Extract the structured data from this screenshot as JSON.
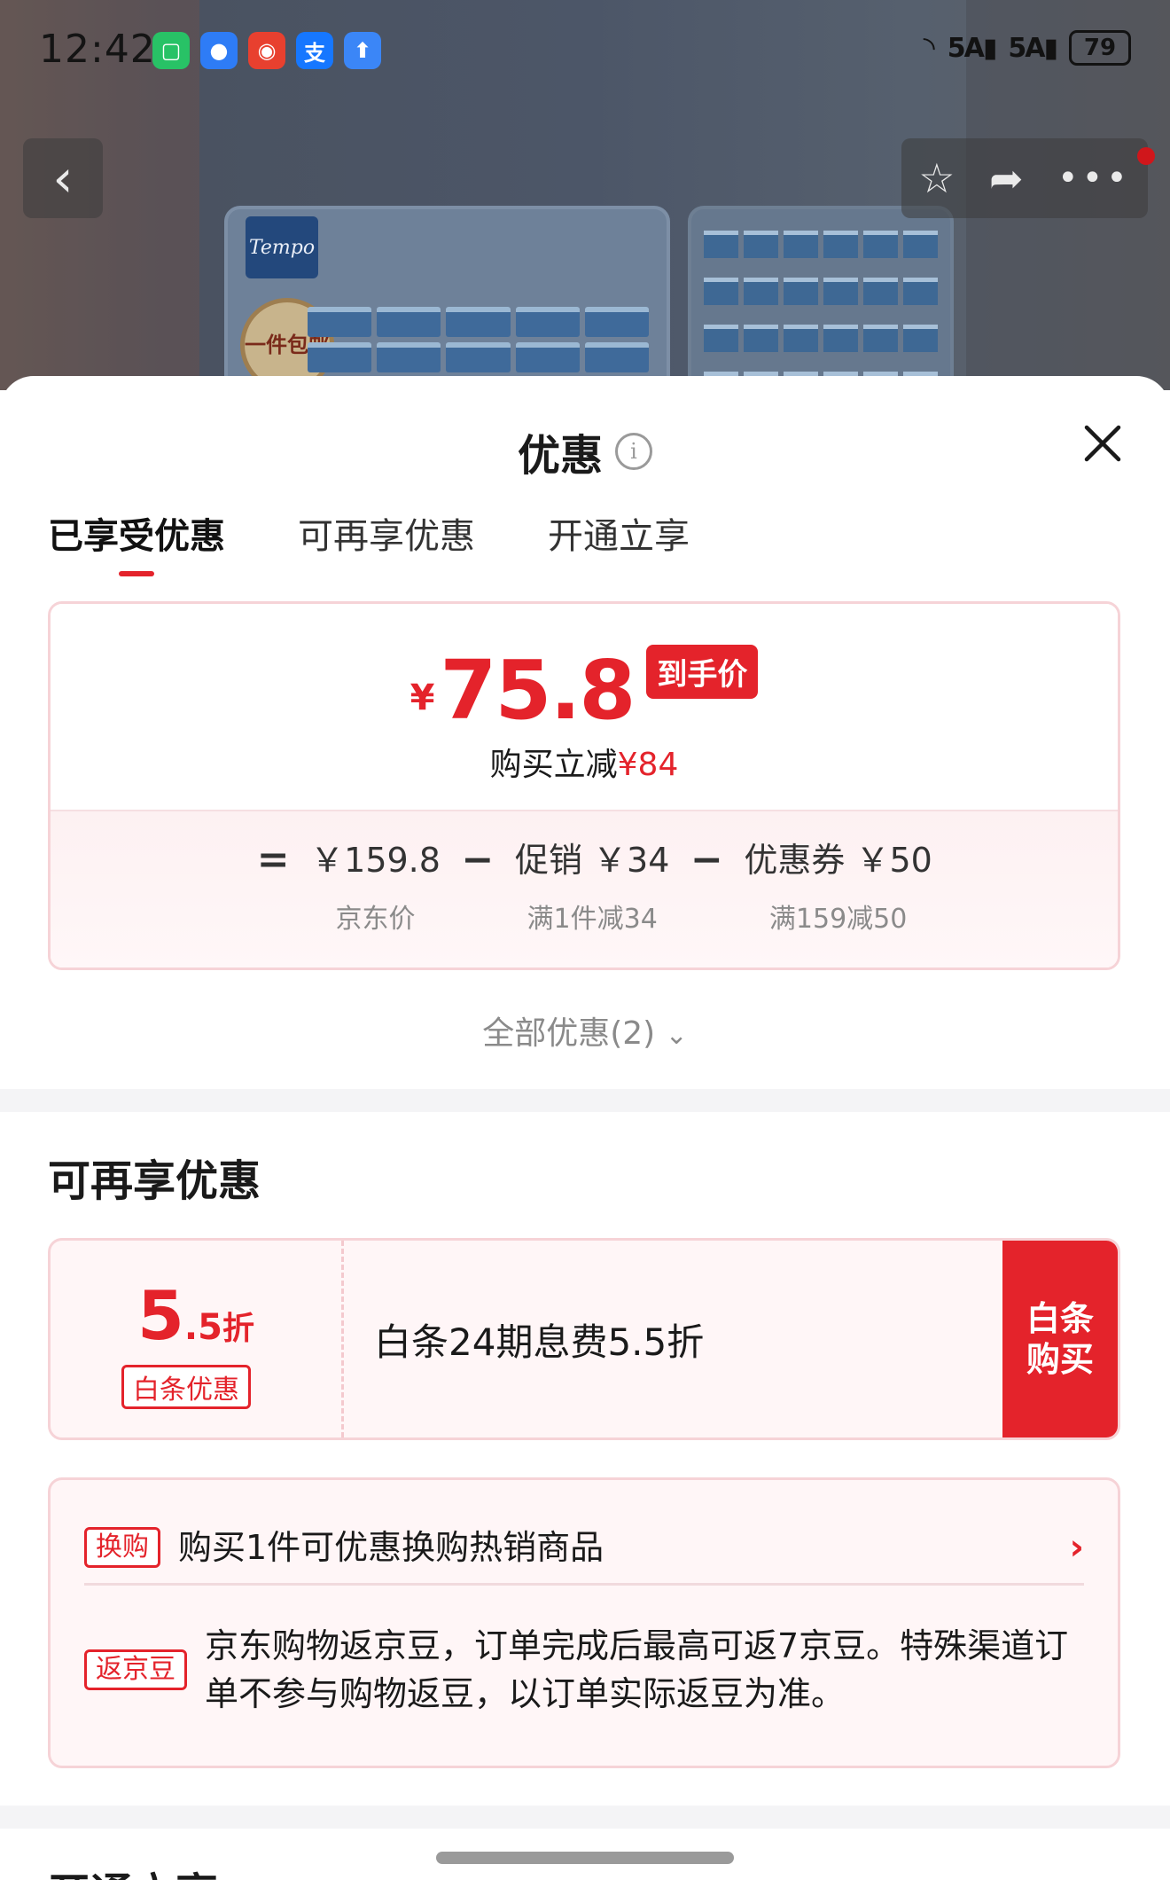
{
  "status_bar": {
    "time": "12:42",
    "apps": [
      {
        "icon": "mijia-icon",
        "glyph": "",
        "color": "#28c266"
      },
      {
        "icon": "message-icon",
        "glyph": "",
        "color": "#2e7cf6"
      },
      {
        "icon": "red-app-icon",
        "glyph": "",
        "color": "#e8402f"
      },
      {
        "icon": "alipay-icon",
        "glyph": "支",
        "color": "#1677ff"
      },
      {
        "icon": "upload-icon",
        "glyph": "",
        "color": "#3b86f7"
      }
    ],
    "signal_1": "5A",
    "signal_2": "5A",
    "battery": "79"
  },
  "background": {
    "brand": "Tempo",
    "badge": "一件包邮"
  },
  "sheet": {
    "title": "优惠",
    "tabs": [
      "已享受优惠",
      "可再享优惠",
      "开通立享"
    ],
    "active_tab": 0
  },
  "price": {
    "currency": "¥",
    "final_price": "75.8",
    "badge": "到手价",
    "saving_label": "购买立减",
    "saving_amount": "¥84",
    "formula": {
      "equals": "=",
      "minus": "−",
      "terms": [
        {
          "value": "￥159.8",
          "label": "京东价"
        },
        {
          "value": "促销 ￥34",
          "label": "满1件减34"
        },
        {
          "value": "优惠券 ￥50",
          "label": "满159减50"
        }
      ]
    }
  },
  "all_offers": "全部优惠(2)",
  "more_offers": {
    "title": "可再享优惠",
    "baitiao": {
      "rate_int": "5",
      "rate_dec": ".5",
      "rate_unit": "折",
      "tag": "白条优惠",
      "desc": "白条24期息费5.5折",
      "button": "白条购买"
    },
    "exchange": {
      "tag": "换购",
      "text": "购买1件可优惠换购热销商品"
    },
    "jingdou": {
      "tag": "返京豆",
      "text": "京东购物返京豆，订单完成后最高可返7京豆。特殊渠道订单不参与购物返豆，以订单实际返豆为准。"
    }
  },
  "next_section": {
    "title": "开通立享"
  },
  "colors": {
    "accent": "#e4232b",
    "card_border": "#f6d3d7"
  }
}
